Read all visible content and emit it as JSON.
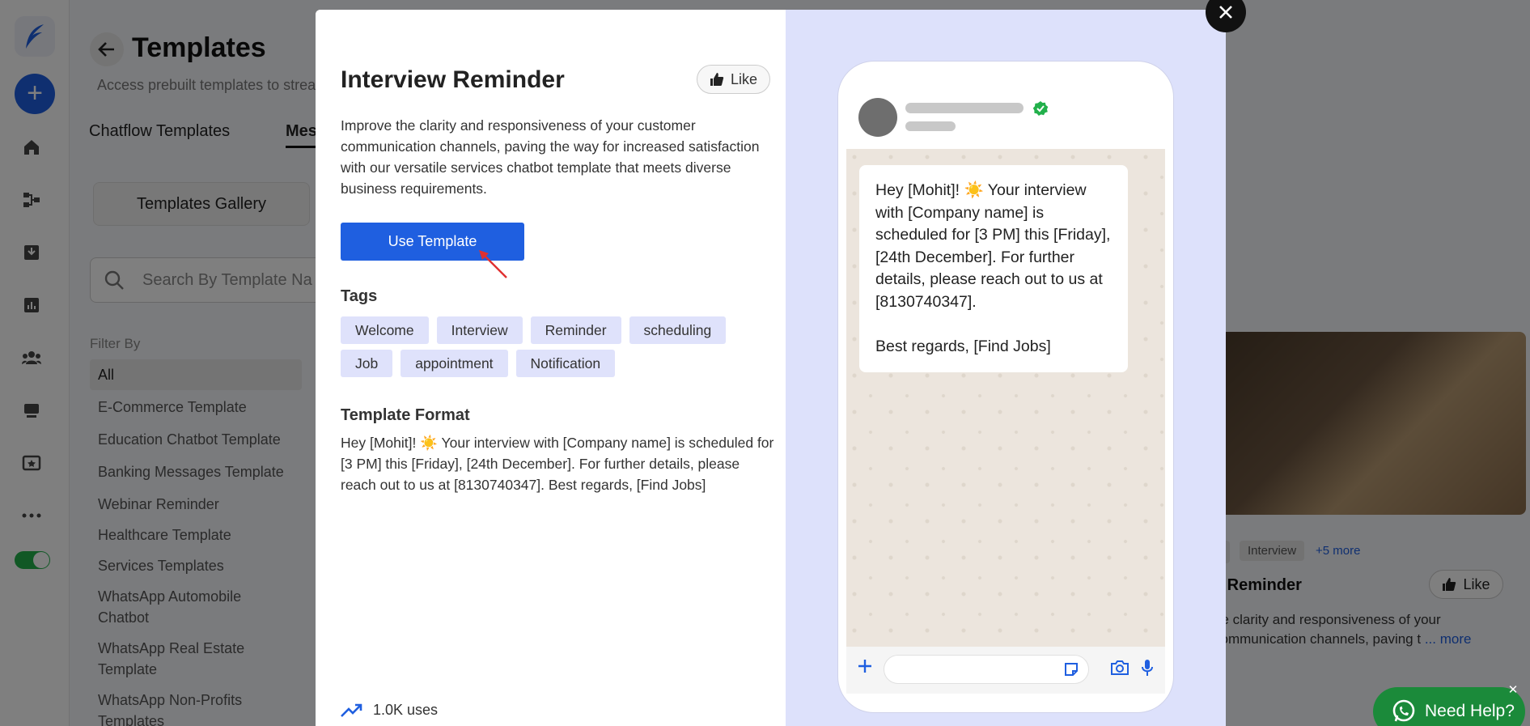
{
  "app": {
    "page_title": "Templates",
    "page_subtitle": "Access prebuilt templates to strea",
    "tabs": [
      "Chatflow Templates",
      "Mes"
    ],
    "gallery_button": "Templates Gallery",
    "search_placeholder": "Search By Template Na",
    "filter_label": "Filter By",
    "filters": [
      "All",
      "E-Commerce Template",
      "Education Chatbot Template",
      "Banking Messages Template",
      "Webinar Reminder",
      "Healthcare Template",
      "Services Templates",
      "WhatsApp Automobile Chatbot",
      "WhatsApp Real Estate Template",
      "WhatsApp Non-Profits Templates"
    ],
    "toggle_on": true
  },
  "bg_card": {
    "tag_interview": "Interview",
    "more_tags": "+5 more",
    "title": "v Reminder",
    "like_label": "Like",
    "desc": "he clarity and responsiveness of your communication channels, paving t",
    "more_link": "... more"
  },
  "help": {
    "label": "Need Help?"
  },
  "modal": {
    "title": "Interview Reminder",
    "like_label": "Like",
    "description": "Improve the clarity and responsiveness of your customer communication channels, paving the way for increased satisfaction with our versatile services chatbot template that meets diverse business requirements.",
    "use_button": "Use Template",
    "tags_title": "Tags",
    "tags": [
      "Welcome",
      "Interview",
      "Reminder",
      "scheduling",
      "Job",
      "appointment",
      "Notification"
    ],
    "format_title": "Template Format",
    "format_body": "Hey [Mohit]! ☀️ Your interview with [Company name] is scheduled for [3 PM] this [Friday], [24th December]. For further details, please reach out to us at [8130740347]. Best regards, [Find Jobs]",
    "uses": "1.0K uses",
    "preview_message": "Hey [Mohit]! ☀️ Your interview with [Company name] is scheduled for [3 PM] this [Friday], [24th December]. For further details, please reach out to us at [8130740347].\n\nBest regards, [Find Jobs]"
  },
  "colors": {
    "brand_blue": "#1f5fe0",
    "tag_bg": "#dfe2fb",
    "preview_bg": "#dde1fb",
    "verified_green": "#22b04b",
    "help_green": "#1b8a3a"
  }
}
